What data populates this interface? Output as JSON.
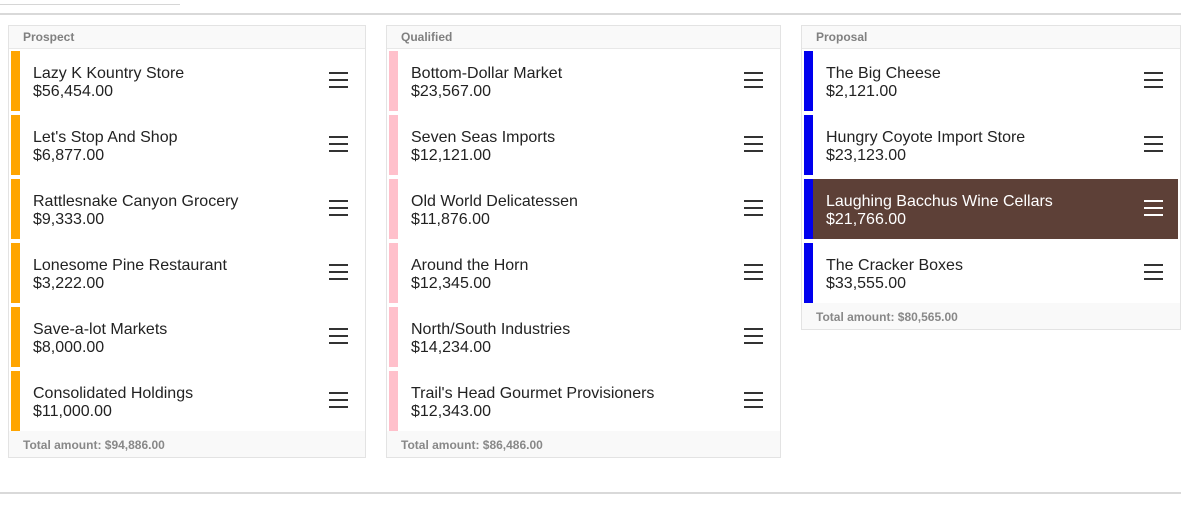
{
  "colors": {
    "prospect_stripe": "#ffa500",
    "qualified_stripe": "#ffc0cb",
    "proposal_stripe": "#0000ee",
    "selected_card_bg": "#5d4037"
  },
  "icons": {
    "card_menu": "hamburger-menu-icon"
  },
  "columns": [
    {
      "title": "Prospect",
      "total": "Total amount: $94,886.00",
      "cards": [
        {
          "name": "Lazy K Kountry Store",
          "amount": "$56,454.00"
        },
        {
          "name": "Let's Stop And Shop",
          "amount": "$6,877.00"
        },
        {
          "name": "Rattlesnake Canyon Grocery",
          "amount": "$9,333.00"
        },
        {
          "name": "Lonesome Pine Restaurant",
          "amount": "$3,222.00"
        },
        {
          "name": "Save-a-lot Markets",
          "amount": "$8,000.00"
        },
        {
          "name": "Consolidated Holdings",
          "amount": "$11,000.00"
        }
      ]
    },
    {
      "title": "Qualified",
      "total": "Total amount: $86,486.00",
      "cards": [
        {
          "name": "Bottom-Dollar Market",
          "amount": "$23,567.00"
        },
        {
          "name": "Seven Seas Imports",
          "amount": "$12,121.00"
        },
        {
          "name": "Old World Delicatessen",
          "amount": "$11,876.00"
        },
        {
          "name": "Around the Horn",
          "amount": "$12,345.00"
        },
        {
          "name": "North/South Industries",
          "amount": "$14,234.00"
        },
        {
          "name": "Trail's Head Gourmet Provisioners",
          "amount": "$12,343.00"
        }
      ]
    },
    {
      "title": "Proposal",
      "total": "Total amount: $80,565.00",
      "cards": [
        {
          "name": "The Big Cheese",
          "amount": "$2,121.00"
        },
        {
          "name": "Hungry Coyote Import Store",
          "amount": "$23,123.00"
        },
        {
          "name": "Laughing Bacchus Wine Cellars",
          "amount": "$21,766.00",
          "selected": true
        },
        {
          "name": "The Cracker Boxes",
          "amount": "$33,555.00"
        }
      ]
    }
  ]
}
